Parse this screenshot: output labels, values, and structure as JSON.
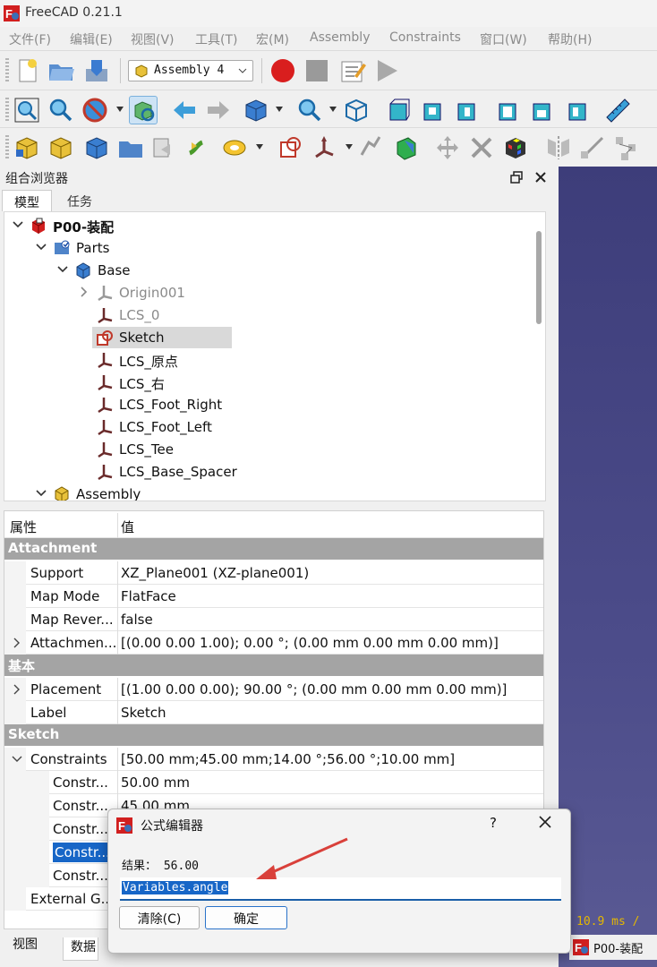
{
  "window": {
    "title": "FreeCAD 0.21.1"
  },
  "menu": [
    "文件(F)",
    "编辑(E)",
    "视图(V)",
    "工具(T)",
    "宏(M)",
    "Assembly",
    "Constraints",
    "窗口(W)",
    "帮助(H)"
  ],
  "toolbar": {
    "assembly_combo": "Assembly 4"
  },
  "combo_view": {
    "title": "组合浏览器",
    "tabs": [
      "模型",
      "任务"
    ],
    "active_tab": "模型"
  },
  "tree": [
    {
      "label": "P00-装配",
      "level": 0,
      "expanded": true,
      "bold": true,
      "icon": "assembly-doc-icon"
    },
    {
      "label": "Parts",
      "level": 1,
      "expanded": true,
      "icon": "parts-folder-icon"
    },
    {
      "label": "Base",
      "level": 2,
      "expanded": true,
      "icon": "part-body-icon"
    },
    {
      "label": "Origin001",
      "level": 3,
      "collapsed": true,
      "grey": true,
      "icon": "origin-icon"
    },
    {
      "label": "LCS_0",
      "level": 3,
      "grey": true,
      "icon": "lcs-icon"
    },
    {
      "label": "Sketch",
      "level": 3,
      "selected": true,
      "icon": "sketch-icon"
    },
    {
      "label": "LCS_原点",
      "level": 3,
      "icon": "lcs-icon"
    },
    {
      "label": "LCS_右",
      "level": 3,
      "icon": "lcs-icon"
    },
    {
      "label": "LCS_Foot_Right",
      "level": 3,
      "icon": "lcs-icon"
    },
    {
      "label": "LCS_Foot_Left",
      "level": 3,
      "icon": "lcs-icon"
    },
    {
      "label": "LCS_Tee",
      "level": 3,
      "icon": "lcs-icon"
    },
    {
      "label": "LCS_Base_Spacer",
      "level": 3,
      "icon": "lcs-icon"
    },
    {
      "label": "Assembly",
      "level": 1,
      "expanded": true,
      "icon": "assembly-icon"
    }
  ],
  "properties": {
    "header": {
      "property": "属性",
      "value": "值"
    },
    "groups": [
      {
        "name": "Attachment",
        "rows": [
          {
            "key": "Support",
            "value": "XZ_Plane001 (XZ-plane001)"
          },
          {
            "key": "Map Mode",
            "value": "FlatFace"
          },
          {
            "key": "Map Rever...",
            "value": "false"
          },
          {
            "key": "Attachmen...",
            "value": "[(0.00 0.00 1.00); 0.00 °; (0.00 mm  0.00 mm  0.00 mm)]",
            "expandable": true
          }
        ]
      },
      {
        "name": "基本",
        "rows": [
          {
            "key": "Placement",
            "value": "[(1.00 0.00 0.00); 90.00 °; (0.00 mm  0.00 mm  0.00 mm)]",
            "expandable": true
          },
          {
            "key": "Label",
            "value": "Sketch"
          }
        ]
      },
      {
        "name": "Sketch",
        "rows": [
          {
            "key": "Constraints",
            "value": "[50.00 mm;45.00 mm;14.00 °;56.00 °;10.00 mm]",
            "expanded": true
          },
          {
            "key": "Constr...",
            "value": "50.00 mm",
            "sub": true
          },
          {
            "key": "Constr...",
            "value": "45.00 mm",
            "sub": true
          },
          {
            "key": "Constr...",
            "value": "",
            "sub": true
          },
          {
            "key": "Constr...",
            "value": "",
            "sub": true,
            "selected": true
          },
          {
            "key": "Constr...",
            "value": "",
            "sub": true
          },
          {
            "key": "External G...",
            "value": ""
          }
        ]
      }
    ]
  },
  "bottom_tabs": [
    "视图",
    "数据"
  ],
  "status": {
    "fps": "10.9 ms /",
    "document_tab": "P00-装配"
  },
  "dialog": {
    "title": "公式编辑器",
    "help": "?",
    "result_label": "结果：",
    "result_value": "56.00",
    "expression": "Variables.angle",
    "clear_button": "清除(C)",
    "ok_button": "确定"
  },
  "colors": {
    "accent": "#1766c7",
    "selection": "#d9d9d9",
    "group_header": "#a4a4a4",
    "view_bg": "#4c4c8a",
    "annotation_arrow": "#d9403a"
  }
}
